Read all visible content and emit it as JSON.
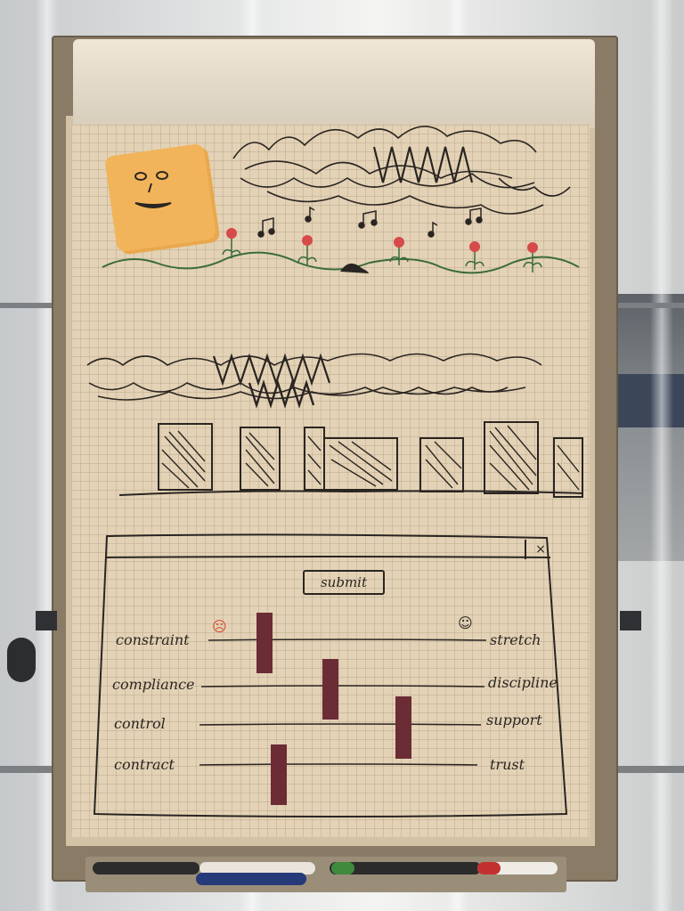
{
  "scene": {
    "description_type": "photo of a flipchart with a hand-drawn sketch",
    "paper_color": "#e3d2b5",
    "ink_color": "#2a2522",
    "thumb_color": "#6b2c36",
    "sun_note_color": "#f2b45a"
  },
  "sketch_window": {
    "submit_label": "submit",
    "close_glyph": "×",
    "sad_face": "☹",
    "happy_face": "☺",
    "sliders": [
      {
        "left_label": "constraint",
        "right_label": "stretch",
        "level": 0.26
      },
      {
        "left_label": "compliance",
        "right_label": "discipline",
        "level": 0.45
      },
      {
        "left_label": "control",
        "right_label": "support",
        "level": 0.72
      },
      {
        "left_label": "contract",
        "right_label": "trust",
        "level": 0.28
      }
    ]
  },
  "icons": {
    "sun": "sun-face-icon",
    "note": "music-note-icon",
    "flower": "flower-icon"
  }
}
